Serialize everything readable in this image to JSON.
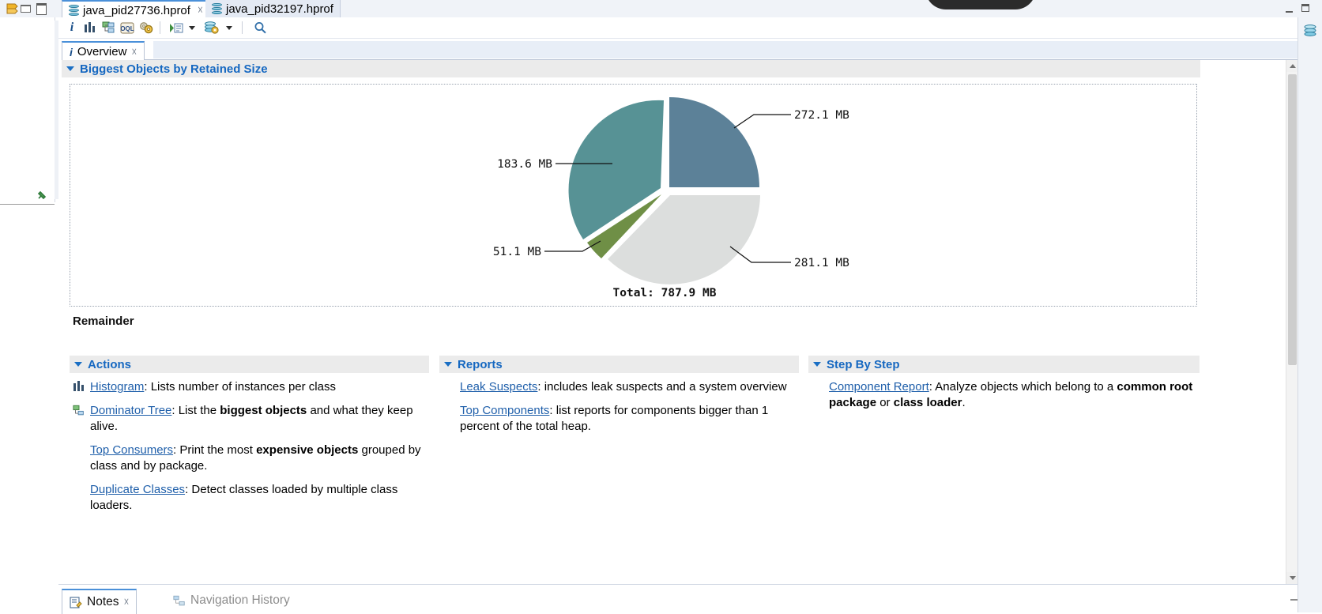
{
  "window": {
    "rail_icons": [
      "restore-arrows-icon",
      "minimize-icon",
      "maximize-icon"
    ],
    "minimize_label": "",
    "maximize_label": ""
  },
  "editor_tabs": [
    {
      "label": "java_pid27736.hprof",
      "icon": "heap-dump-icon",
      "active": true,
      "close": "☓"
    },
    {
      "label": "java_pid32197.hprof",
      "icon": "heap-dump-icon",
      "active": false,
      "close": ""
    }
  ],
  "toolbar": {
    "items": [
      {
        "name": "overview-info-button",
        "icon": "info-icon",
        "label": "i"
      },
      {
        "name": "histogram-button",
        "icon": "histogram-icon",
        "label": ""
      },
      {
        "name": "dominator-tree-button",
        "icon": "dominator-tree-icon",
        "label": ""
      },
      {
        "name": "oql-button",
        "icon": "oql-icon",
        "label": "OQL"
      },
      {
        "name": "inspect-button",
        "icon": "gears-icon",
        "label": ""
      },
      {
        "name": "run-expert-system-test-button",
        "icon": "run-report-icon",
        "label": ""
      },
      {
        "name": "query-browser-button",
        "icon": "query-browser-icon",
        "label": ""
      },
      {
        "name": "find-button",
        "icon": "search-icon",
        "label": ""
      }
    ]
  },
  "view_tab": {
    "label": "Overview",
    "icon": "overview-info-icon",
    "close": "☓"
  },
  "sections": {
    "biggest_objects": {
      "title": "Biggest Objects by Retained Size",
      "remainder_label": "Remainder"
    },
    "actions": {
      "title": "Actions",
      "items": [
        {
          "icon": "histogram-icon",
          "link": "Histogram",
          "rest_plain_1": ": Lists number of instances per class",
          "bold": "",
          "rest_plain_2": ""
        },
        {
          "icon": "dominator-tree-icon",
          "link": "Dominator Tree",
          "rest_plain_1": ": List the ",
          "bold": "biggest objects",
          "rest_plain_2": " and what they keep alive."
        },
        {
          "icon": "",
          "link": "Top Consumers",
          "rest_plain_1": ": Print the most ",
          "bold": "expensive objects",
          "rest_plain_2": " grouped by class and by package."
        },
        {
          "icon": "",
          "link": "Duplicate Classes",
          "rest_plain_1": ": Detect classes loaded by multiple class loaders.",
          "bold": "",
          "rest_plain_2": ""
        }
      ]
    },
    "reports": {
      "title": "Reports",
      "items": [
        {
          "icon": "",
          "link": "Leak Suspects",
          "rest_plain_1": ": includes leak suspects and a system overview",
          "bold": "",
          "rest_plain_2": ""
        },
        {
          "icon": "",
          "link": "Top Components",
          "rest_plain_1": ": list reports for components bigger than 1 percent of the total heap.",
          "bold": "",
          "rest_plain_2": ""
        }
      ]
    },
    "step_by_step": {
      "title": "Step By Step",
      "items": [
        {
          "icon": "",
          "link": "Component Report",
          "rest_plain_1": ": Analyze objects which belong to a ",
          "bold": "common root package",
          "rest_mid": " or ",
          "bold2": "class loader",
          "rest_plain_2": "."
        }
      ]
    }
  },
  "bottom_tabs": [
    {
      "label": "Notes",
      "icon": "notes-icon",
      "active": true,
      "close": "☓"
    },
    {
      "label": "Navigation History",
      "icon": "navigation-history-icon",
      "active": false,
      "close": ""
    }
  ],
  "chart_data": {
    "type": "pie",
    "title": "Biggest Objects by Retained Size",
    "unit": "MB",
    "total_label": "Total: 787.9 MB",
    "total_value": 787.9,
    "legend_position": "none",
    "labels": [
      "272.1 MB",
      "281.1 MB",
      "51.1 MB",
      "183.6 MB"
    ],
    "values": [
      272.1,
      281.1,
      51.1,
      183.6
    ],
    "colors": [
      "#5c8198",
      "#dcdedd",
      "#6f8f46",
      "#579295"
    ],
    "slice_annotations": [
      {
        "label": "272.1 MB",
        "side": "right",
        "color": "#5c8198"
      },
      {
        "label": "281.1 MB",
        "side": "right",
        "color": "#dcdedd"
      },
      {
        "label": "51.1 MB",
        "side": "left",
        "color": "#6f8f46"
      },
      {
        "label": "183.6 MB",
        "side": "left",
        "color": "#579295"
      }
    ]
  }
}
